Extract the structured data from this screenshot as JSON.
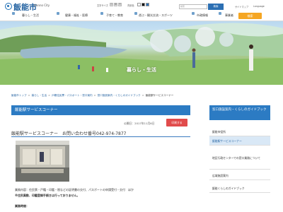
{
  "header": {
    "city_name": "飯能市",
    "city_name_en": "Hanno City",
    "fontsize_label": "文字サイズ",
    "fontsize_small": "小",
    "fontsize_mid": "中",
    "fontsize_large": "大",
    "color_label": "背景色",
    "search_placeholder": "検索",
    "search_button": "検索",
    "sitemap_link": "サイトマップ",
    "language_link": "Language"
  },
  "nav": {
    "items": [
      {
        "label": "暮らし・生活"
      },
      {
        "label": "健康・福祉・医療"
      },
      {
        "label": "子育て・教育"
      },
      {
        "label": "遊ぶ・観光交流・スポーツ"
      },
      {
        "label": "市政情報"
      },
      {
        "label": "事業者"
      }
    ],
    "search_label": "検索"
  },
  "hero": {
    "title": "暮らし・生活"
  },
  "breadcrumb": [
    {
      "label": "飯能市トップ"
    },
    {
      "label": "暮らし・生活"
    },
    {
      "label": "戸籍住民票・パスポート・窓口案内"
    },
    {
      "label": "窓口施設案内・くらしのガイドブック"
    },
    {
      "label": "飯能駅サービスコーナー"
    }
  ],
  "main": {
    "title": "飯能駅サービスコーナー",
    "update_date": "公開日：2017年11月6日",
    "print_label": "印刷する",
    "heading": "飯能駅サービスコーナー　お問い合わせ番号042-974-7877",
    "body_line1": "業務内容：住民票・戸籍・印鑑・税などの証明書の交付、パスポートの申請受付・交付　ほか",
    "body_line2": "※住民異動、印鑑登録手続きは行っておりません。",
    "body_line3": "業務時間："
  },
  "sidebar": {
    "title": "窓口施設案内・くらしのガイドブック",
    "items": [
      {
        "label": "飯能市役所"
      },
      {
        "label": "飯能駅サービスコーナー"
      },
      {
        "label": "地区行政センターでの窓口業務について"
      },
      {
        "label": "広域施設案内"
      },
      {
        "label": "飯能くらしのガイドブック"
      }
    ]
  },
  "colors": {
    "accent": "#2c7bc3",
    "nav_search": "#f5a623",
    "print": "#e14b4b"
  }
}
